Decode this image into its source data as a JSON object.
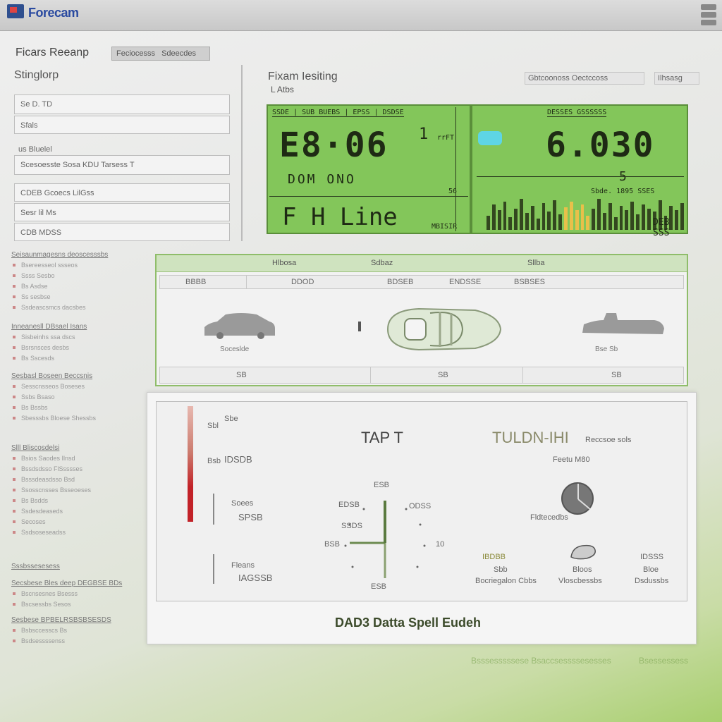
{
  "app": {
    "title": "Forecam"
  },
  "left": {
    "header": "Ficars Reeanp",
    "header_button": "Feciocesss",
    "header_button_tab": "Sdeecdes",
    "subheader": "Stinglorp",
    "rows": [
      {
        "label": "",
        "value": "Se D.    TD"
      },
      {
        "label": "Sfals",
        "value": ""
      },
      {
        "label": "us Bluelel",
        "value": ""
      },
      {
        "label": "",
        "value": "Scesoesste Sosa    KDU     Tarsess    T"
      },
      {
        "label": "",
        "value": "CDEB  Gcoecs  LilGss"
      },
      {
        "label": "",
        "value": "Sesr   lil    Ms"
      },
      {
        "label": "",
        "value": "CDB             MDSS"
      }
    ]
  },
  "display": {
    "header": "Fixam Iesiting",
    "sub": "L Atbs",
    "right_label": "Gbtcoonoss Oectccoss",
    "right_button": "Ilhsasg",
    "lcd1": {
      "top_text": "SSDE | SUB BUEBS | EPSS | DSDSE",
      "big": "E8·06",
      "big_suffix": "1",
      "unit": "rrFT",
      "mid": "DOM     ONO",
      "small_right": "56",
      "bottom": "F   H   Line",
      "bottom_right": "MBISIR"
    },
    "lcd2": {
      "top_text": "DESSES GSSSSSS",
      "big": "6.030",
      "mid_small": "5",
      "small_right": "Sbde. 1895 SSES",
      "bottom": "DEB  SSS"
    }
  },
  "mid_panel": {
    "tabs": [
      "Hlbosa",
      "Sdbaz",
      "Sllba"
    ],
    "columns": [
      "BBBB",
      "DDOD",
      "BDSEB",
      "ENDSSE",
      "BSBSES"
    ],
    "car_labels": [
      "Soceslde",
      "",
      "Bse Sb"
    ],
    "footer": [
      "SB",
      "SB",
      "SB"
    ]
  },
  "main_panel": {
    "title_left": "TAP T",
    "title_right": "TULDN-IHI",
    "title_right_sub": "Reccsoe sols",
    "sub_label": "Feetu M80",
    "gauge_label": "ESB",
    "labels_left": [
      "Sbl",
      "Sbe",
      "Bsb",
      "IDSDB",
      "Soees",
      "SPSB",
      "Fleans",
      "IAGSSB"
    ],
    "gauge_ticks": [
      "EDSB",
      "ODSS",
      "SSDS",
      "BSB",
      "10",
      "ESB"
    ],
    "bottom_items": [
      {
        "top": "IBDBB",
        "mid": "Sbb",
        "low": "Bocriegalon Cbbs"
      },
      {
        "top": "",
        "mid": "Bloos",
        "low": "Vloscbessbs"
      },
      {
        "top": "IDSSS",
        "mid": "Bloe",
        "low": "Dsdussbs"
      }
    ],
    "right_label": "Fldtecedbs",
    "footer": "DAD3 Datta Spell Eudeh"
  },
  "sidebar": [
    {
      "head": "Seisaunmagesns deoscesssbs",
      "items": [
        "Bsereesseol ssseos",
        "Ssss Sesbo",
        "Bs Asdse",
        "Ss sesbse",
        "Ssdeascsmcs dacsbes"
      ]
    },
    {
      "head": "Inneanesll DBsael Isans",
      "items": [
        "Sisbeinhs ssa dscs",
        "Bsrsnsces desbs",
        "Bs Sscesds"
      ]
    },
    {
      "head": "Sesbasl Boseen Beccsnis",
      "items": [
        "Sesscnsseos Boseses",
        "Ssbs Bsaso",
        "Bs Bssbs",
        "Sbesssbs Bloese Shessbs"
      ]
    },
    {
      "head": "Slll Bliscosdelsi",
      "items": [
        "Bsios Saodes Ilnsd",
        "Bssdsdsso FlSsssses",
        "Bsssdeasdsso Bsd",
        "Ssosscnsses Bsseoeses",
        "Bs Bsdds",
        "Ssdesdeaseds",
        "Secoses",
        "Ssdsoseseadss"
      ]
    },
    {
      "head": "Sssbssesesess",
      "items": []
    },
    {
      "head": "Secsbese Bles deep DEGBSE BDs",
      "items": [
        "Bscnsesnes Bsesss",
        "Bscsessbs Sesos"
      ]
    },
    {
      "head": "Sesbese BPBELRSBSBSESDS",
      "items": [
        "Bsbsccesscs Bs",
        "Bsdsessssenss"
      ]
    }
  ],
  "bottom_faint": [
    "Bsssesssssese Bsaccsessssesesses",
    "Bsessessess"
  ],
  "colors": {
    "lcd": "#83c65a",
    "accent_green": "#8fbd6a",
    "title_blue": "#2a4aa0",
    "red_level": "#c22228"
  }
}
